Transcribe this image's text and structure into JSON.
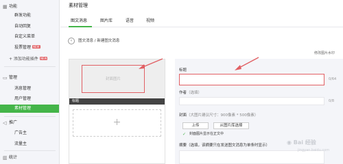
{
  "sidebar": {
    "groups": [
      {
        "title": "功能",
        "icon": "puzzle-icon"
      },
      {
        "title": "管理",
        "icon": "manage-icon"
      },
      {
        "title": "推广",
        "icon": "megaphone-icon"
      },
      {
        "title": "统计",
        "icon": "chart-icon"
      }
    ],
    "func_items": [
      {
        "label": "群发功能"
      },
      {
        "label": "自动回复"
      },
      {
        "label": "自定义菜单"
      },
      {
        "label": "投票管理",
        "badge": "NEW"
      }
    ],
    "add_plugin": "+ 添加功能插件",
    "add_plugin_badge": "NEW",
    "manage_items": [
      {
        "label": "消息管理"
      },
      {
        "label": "用户管理"
      },
      {
        "label": "素材管理",
        "active": true
      }
    ],
    "promo_items": [
      {
        "label": "广告主"
      },
      {
        "label": "流量主"
      }
    ]
  },
  "page_title": "素材管理",
  "tabs": [
    {
      "label": "图文消息",
      "active": true
    },
    {
      "label": "图片库"
    },
    {
      "label": "语音"
    },
    {
      "label": "视频"
    }
  ],
  "breadcrumb": "图文消息 / 新建图文消息",
  "watermark_link": "修改图片水印",
  "editor": {
    "cover_placeholder": "封面图片",
    "title_bar": "标题",
    "add_symbol": "+"
  },
  "form": {
    "title_label": "标题",
    "title_count": "0/64",
    "author_label": "作者",
    "author_hint": "（选填）",
    "author_count": "0/8",
    "cover_label": "封面",
    "cover_hint": "（大图片建议尺寸：900像素 * 500像素）",
    "upload_btn": "上传",
    "select_btn": "从图片库选择",
    "show_cover_check": "✓",
    "show_cover_label": "封面图片显示在正文中",
    "abstract_label": "摘要（选填，该摘要只在发送图文消息为单条时显示）"
  },
  "colors": {
    "accent_green": "#44b549",
    "highlight_red": "#e15f63"
  }
}
